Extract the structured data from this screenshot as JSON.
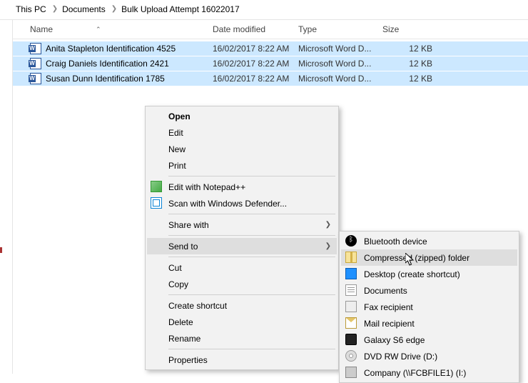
{
  "breadcrumb": [
    "This PC",
    "Documents",
    "Bulk Upload Attempt 16022017"
  ],
  "columns": {
    "name": "Name",
    "date": "Date modified",
    "type": "Type",
    "size": "Size"
  },
  "files": [
    {
      "name": "Anita Stapleton Identification 4525",
      "date": "16/02/2017 8:22 AM",
      "type": "Microsoft Word D...",
      "size": "12 KB"
    },
    {
      "name": "Craig Daniels Identification 2421",
      "date": "16/02/2017 8:22 AM",
      "type": "Microsoft Word D...",
      "size": "12 KB"
    },
    {
      "name": "Susan Dunn Identification 1785",
      "date": "16/02/2017 8:22 AM",
      "type": "Microsoft Word D...",
      "size": "12 KB"
    }
  ],
  "menu": {
    "open": "Open",
    "edit": "Edit",
    "new": "New",
    "print": "Print",
    "edit_np": "Edit with Notepad++",
    "scan_def": "Scan with Windows Defender...",
    "share_with": "Share with",
    "send_to": "Send to",
    "cut": "Cut",
    "copy": "Copy",
    "create_shortcut": "Create shortcut",
    "delete": "Delete",
    "rename": "Rename",
    "properties": "Properties"
  },
  "sendto": {
    "bluetooth": "Bluetooth device",
    "zip": "Compressed (zipped) folder",
    "desktop": "Desktop (create shortcut)",
    "documents": "Documents",
    "fax": "Fax recipient",
    "mail": "Mail recipient",
    "galaxy": "Galaxy S6 edge",
    "dvd": "DVD RW Drive (D:)",
    "company": "Company (\\\\FCBFILE1) (I:)"
  }
}
